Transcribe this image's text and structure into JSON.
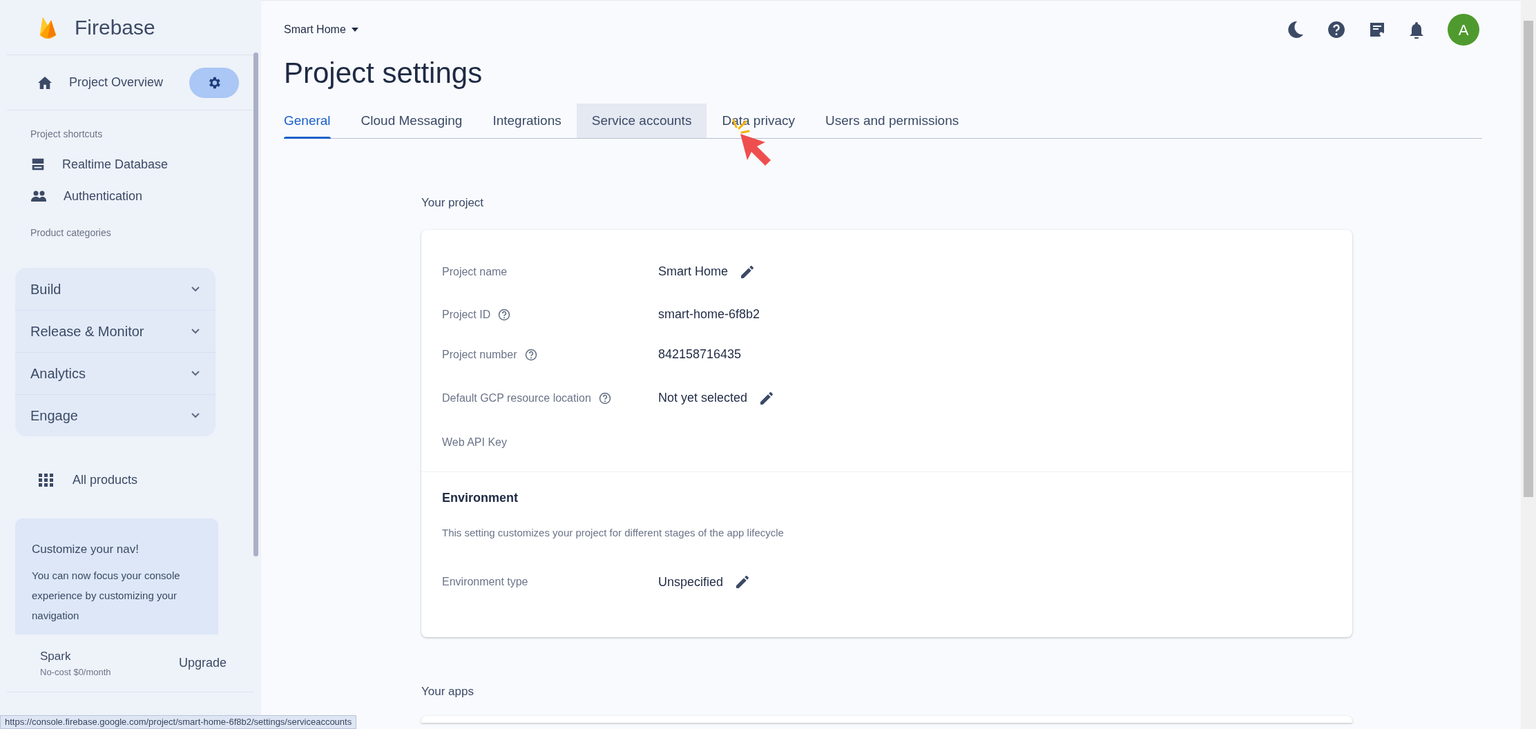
{
  "sidebar": {
    "brand": "Firebase",
    "overview": {
      "label": "Project Overview"
    },
    "shortcuts_heading": "Project shortcuts",
    "shortcuts": [
      {
        "label": "Realtime Database",
        "kind": "database"
      },
      {
        "label": "Authentication",
        "kind": "people"
      }
    ],
    "categories_heading": "Product categories",
    "categories": [
      {
        "label": "Build",
        "expanded": false
      },
      {
        "label": "Release & Monitor",
        "expanded": false
      },
      {
        "label": "Analytics",
        "expanded": false
      },
      {
        "label": "Engage",
        "expanded": false
      }
    ],
    "all_products": "All products",
    "promo": {
      "title": "Customize your nav!",
      "body": "You can now focus your console experience by customizing your navigation"
    },
    "plan": {
      "name": "Spark",
      "price": "No-cost $0/month",
      "action": "Upgrade"
    }
  },
  "header": {
    "project": "Smart Home",
    "avatar": "A"
  },
  "title": "Project settings",
  "tabs": [
    {
      "label": "General",
      "selected": true,
      "hovered": false
    },
    {
      "label": "Cloud Messaging",
      "selected": false,
      "hovered": false
    },
    {
      "label": "Integrations",
      "selected": false,
      "hovered": false
    },
    {
      "label": "Service accounts",
      "selected": false,
      "hovered": true
    },
    {
      "label": "Data privacy",
      "selected": false,
      "hovered": false
    },
    {
      "label": "Users and permissions",
      "selected": false,
      "hovered": false
    }
  ],
  "your_project": {
    "heading": "Your project",
    "fields": [
      {
        "label": "Project name",
        "help": false,
        "value": "Smart Home",
        "editable": true
      },
      {
        "label": "Project ID",
        "help": true,
        "value": "smart-home-6f8b2",
        "editable": false
      },
      {
        "label": "Project number",
        "help": true,
        "value": "842158716435",
        "editable": false
      },
      {
        "label": "Default GCP resource location",
        "help": true,
        "value": "Not yet selected",
        "editable": true
      },
      {
        "label": "Web API Key",
        "help": false,
        "editable": false
      }
    ],
    "environment": {
      "heading": "Environment",
      "description": "This setting customizes your project for different stages of the app lifecycle",
      "fields": [
        {
          "label": "Environment type",
          "help": false,
          "value": "Unspecified",
          "editable": true
        }
      ]
    }
  },
  "your_apps": {
    "heading": "Your apps"
  },
  "status_url": "https://console.firebase.google.com/project/smart-home-6f8b2/settings/serviceaccounts"
}
